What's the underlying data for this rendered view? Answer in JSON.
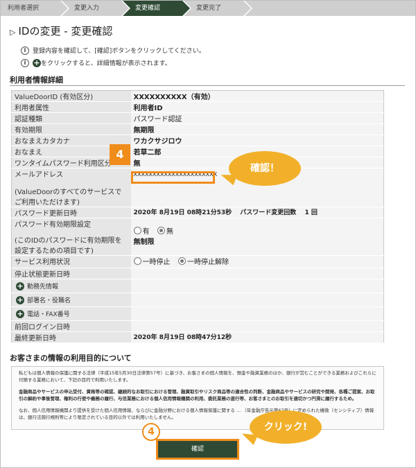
{
  "steps": [
    "利用者選択",
    "変更入力",
    "変更確認",
    "変更完了"
  ],
  "active_step": 2,
  "page_title": "IDの変更 - 変更確認",
  "notes": {
    "line1": "登録内容を確認して、[確認]ボタンをクリックしてください。",
    "line2": "をクリックすると、詳細情報が表示されます。"
  },
  "section_user": "利用者情報詳細",
  "rows": {
    "valuedoor_id": {
      "label": "ValueDoorID (有効区分)",
      "value": "XXXXXXXXXX（有効）"
    },
    "attr": {
      "label": "利用者属性",
      "value": "利用者ID"
    },
    "auth": {
      "label": "認証種類",
      "value": "パスワード認証"
    },
    "period": {
      "label": "有効期限",
      "value": "無期限"
    },
    "kana": {
      "label": "おなまえカタカナ",
      "value": "ワカクサジロウ"
    },
    "name": {
      "label": "おなまえ",
      "value": "若草二郎"
    },
    "otp": {
      "label": "ワンタイムパスワード利用区分",
      "value": "無"
    },
    "mail": {
      "label": "メールアドレス",
      "sub": "(ValueDoorのすべてのサービスでご利用いただけます)",
      "value": "XXXXXXXXXXXXXXXXXXXXXX"
    },
    "pw_update": {
      "label": "パスワード更新日時",
      "value": "2020年 8月19日 08時21分53秒 　パスワード変更回数 　1 回"
    },
    "pw_expiry": {
      "label": "パスワード有効期限設定",
      "sub": "(このIDのパスワードに有効期限を設定するための項目です)",
      "opt_yes": "有",
      "opt_no": "無",
      "value": "無制限"
    },
    "service": {
      "label": "サービス利用状況",
      "opt_stop": "一時停止",
      "opt_release": "一時停止解除"
    },
    "stop_update": {
      "label": "停止状態更新日時",
      "value": ""
    },
    "work": {
      "label": "勤務先情報"
    },
    "dept": {
      "label": "部署名・役職名"
    },
    "phone": {
      "label": "電話・FAX番号"
    },
    "last_login": {
      "label": "前回ログイン日時",
      "value": ""
    },
    "last_update": {
      "label": "最終更新日時",
      "value": "2020年 8月19日 08時47分12秒"
    }
  },
  "annot": {
    "badge": "4",
    "bubble1": "確認！",
    "bubble2": "クリック!",
    "circle": "4"
  },
  "section_purpose": "お客さまの情報の利用目的について",
  "purpose": {
    "p1": "私どもは個人情報の保護に関する法律（平成15年5月30日法律第57号）に基づき、お客さまの個人情報を、預金や融資業務のほか、銀行が営むことができる業務およびこれらに付随する業務において、下記の目的で利用いたします。",
    "p2": "金融商品やサービスの申込受付、資格等の確認、継続的なお取引における管理、融資取引やリスク商品等の適合性の判断、金融商品やサービスの研究や開発、各種ご提案、お取引の解約や事後管理、権利の行使や義務の履行、与信業務における個人信用情報機関の利用、委託業務の遂行等、お客さまとのお取引を適切かつ円滑に履行するため。",
    "p3": "なお、個人信用情報機関より提供を受けた個人信用情報、ならびに金融分野における個人情報保護に関する ... （年金融庁告示第67号）に定められた機微（センシティブ）情報は、銀行法施行規則等により限定されている目的以外では利用いたしません。"
  },
  "confirm_label": "確認"
}
